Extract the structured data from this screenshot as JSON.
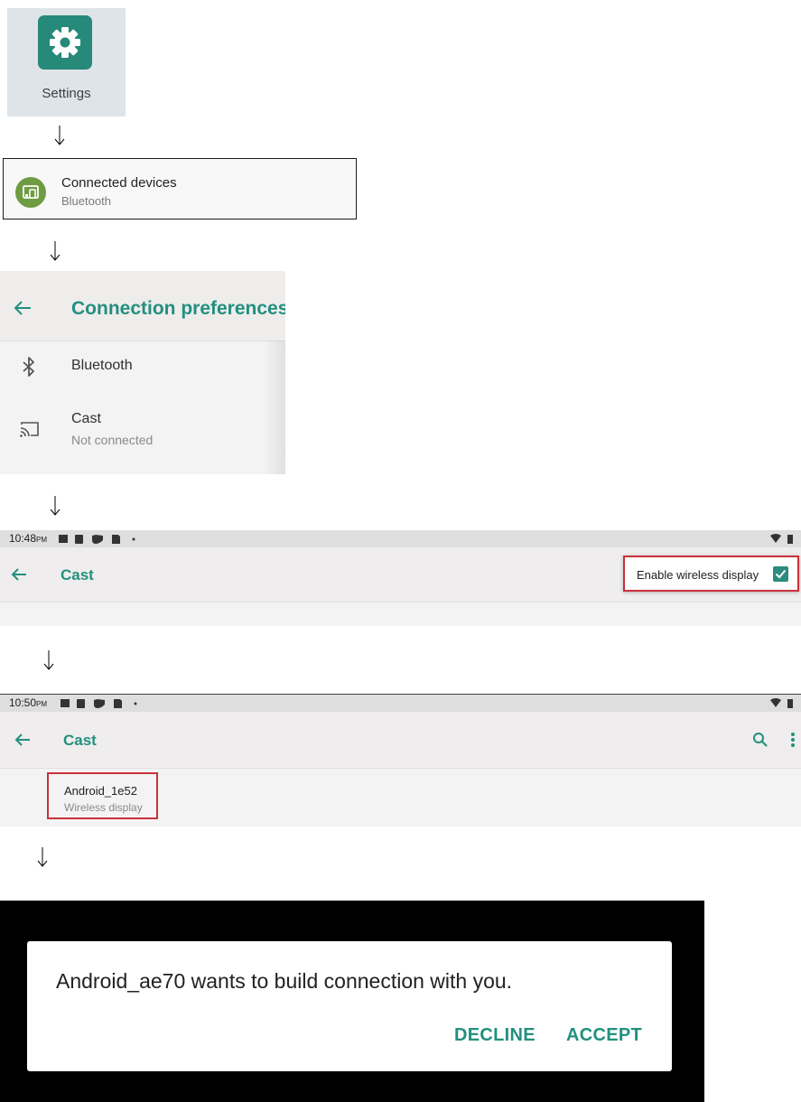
{
  "step_settings": {
    "label": "Settings",
    "icon": "gear-icon",
    "accent": "#26897a"
  },
  "step_connected": {
    "title": "Connected devices",
    "subtitle": "Bluetooth",
    "icon": "devices-icon",
    "accent": "#6f9c42"
  },
  "step_prefs": {
    "title": "Connection preferences",
    "items": [
      {
        "label": "Bluetooth",
        "icon": "bluetooth-icon"
      },
      {
        "label": "Cast",
        "sub": "Not connected",
        "icon": "cast-icon"
      }
    ]
  },
  "step_cast_enable": {
    "time": "10:48",
    "ampm": "PM",
    "title": "Cast",
    "menu_label": "Enable wireless display",
    "checked": true
  },
  "step_cast_device": {
    "time": "10:50",
    "ampm": "PM",
    "title": "Cast",
    "device_name": "Android_1e52",
    "device_sub": "Wireless display"
  },
  "step_dialog": {
    "message": "Android_ae70 wants to build connection with you.",
    "decline": "DECLINE",
    "accept": "ACCEPT"
  },
  "colors": {
    "teal": "#22907f",
    "highlight": "#c9323a"
  }
}
